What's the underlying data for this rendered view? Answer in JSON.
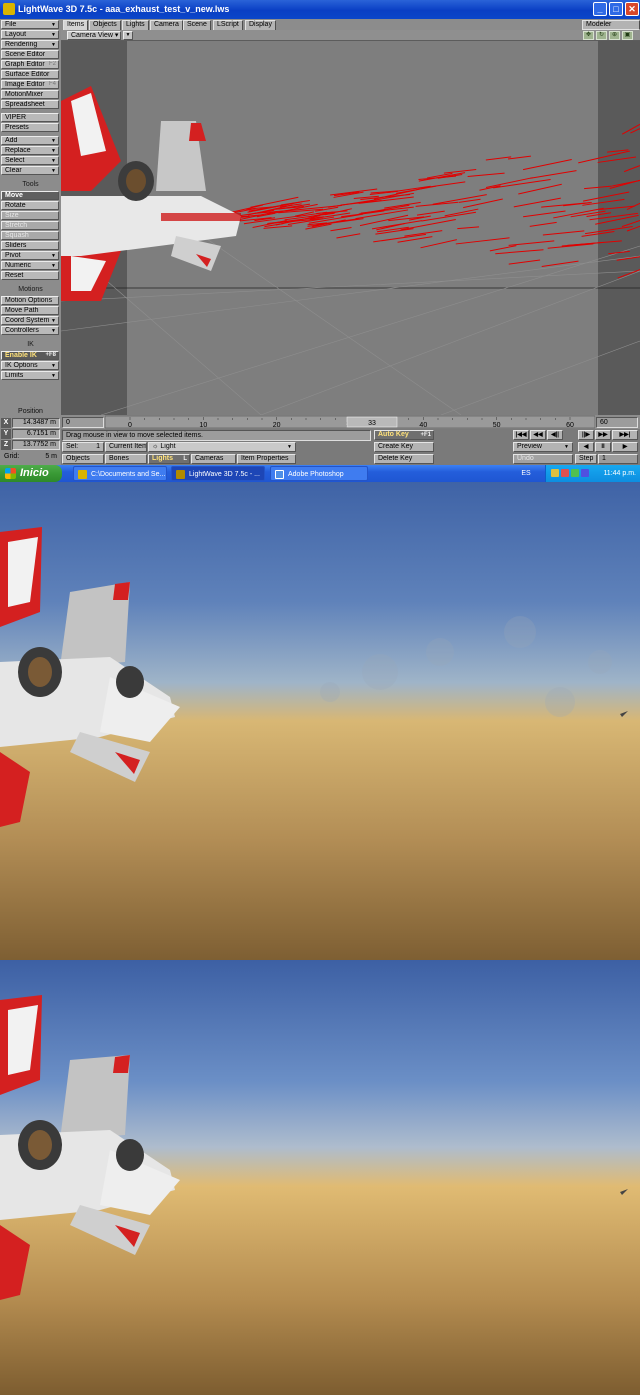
{
  "window": {
    "title": "LightWave 3D 7.5c - aaa_exhaust_test_v_new.lws",
    "minimize": "_",
    "maximize": "□",
    "close": "✕"
  },
  "menu": {
    "file": "File",
    "layout": "Layout",
    "rendering": "Rendering",
    "scene_editor": "Scene Editor",
    "graph_editor": "Graph Editor",
    "graph_editor_key": "F2",
    "surface_editor": "Surface Editor",
    "image_editor": "Image Editor",
    "image_editor_key": "F4",
    "motion_mixer": "MotionMixer",
    "spreadsheet": "Spreadsheet",
    "viper": "VIPER",
    "presets": "Presets",
    "add": "Add",
    "replace": "Replace",
    "select": "Select",
    "clear": "Clear"
  },
  "tools": {
    "heading": "Tools",
    "move": "Move",
    "rotate": "Rotate",
    "size": "Size",
    "stretch": "Stretch",
    "squash": "Squash",
    "sliders": "Sliders",
    "pivot": "Pivot",
    "numeric": "Numeric",
    "reset": "Reset"
  },
  "motions": {
    "heading": "Motions",
    "motion_options": "Motion Options",
    "move_path": "Move Path",
    "coord_system": "Coord System",
    "controllers": "Controllers"
  },
  "ik": {
    "heading": "IK",
    "enable_ik": "Enable IK",
    "enable_ik_key": "+F8",
    "ik_options": "IK Options",
    "limits": "Limits"
  },
  "tabs": [
    "Items",
    "Objects",
    "Lights",
    "Camera",
    "Scene",
    "LScript",
    "Display"
  ],
  "modeler": "Modeler",
  "viewport": {
    "view_mode": "Camera View"
  },
  "timeline": {
    "start": "0",
    "end": "60",
    "current": "33",
    "ticks": [
      "0",
      "10",
      "20",
      "30",
      "40",
      "50",
      "60"
    ]
  },
  "position": {
    "heading": "Position",
    "x_label": "X",
    "y_label": "Y",
    "z_label": "Z",
    "x": "14.3487 m",
    "y": "6.7151 m",
    "z": "13.7752 m",
    "grid_label": "Grid:",
    "grid": "5 m"
  },
  "status": {
    "message": "Drag mouse in view to move selected items."
  },
  "item": {
    "sel_label": "Sel:",
    "sel_count": "1",
    "current_item_label": "Current Item",
    "current_item": "Light",
    "objects": "Objects",
    "bones": "Bones",
    "lights": "Lights",
    "lights_key": "L",
    "cameras": "Cameras",
    "item_properties": "Item Properties"
  },
  "keys": {
    "auto_key": "Auto Key",
    "auto_key_shortcut": "+F1",
    "create_key": "Create Key",
    "delete_key": "Delete Key"
  },
  "playback": {
    "preview": "Preview",
    "undo": "Undo",
    "step_label": "Step",
    "step": "1"
  },
  "taskbar": {
    "start": "Inicio",
    "tasks": [
      "C:\\Documents and Se...",
      "LightWave 3D 7.5c - ...",
      "Adobe Photoshop"
    ],
    "language": "ES",
    "clock": "11:44 p.m."
  },
  "colors": {
    "exhaust_particles": "#e00000",
    "aircraft_red": "#d42020",
    "aircraft_white": "#f2f2f2",
    "sky_blue": "#4a70b0",
    "haze": "#d8b774",
    "ground": "#8a6a3a"
  }
}
